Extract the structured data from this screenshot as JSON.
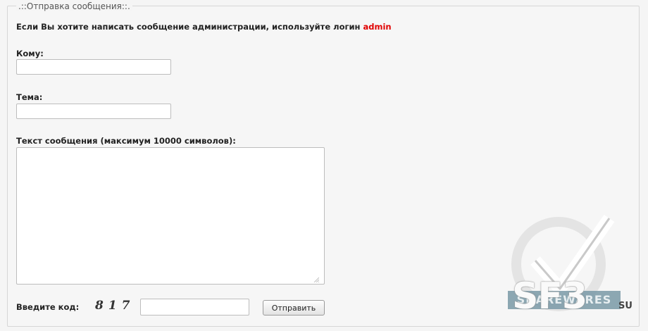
{
  "form": {
    "legend": ".::Отправка сообщения::.",
    "notice_text": "Если Вы хотите написать сообщение администрации, используйте логин ",
    "notice_login": "admin",
    "to_label": "Кому:",
    "to_value": "",
    "subject_label": "Тема:",
    "subject_value": "",
    "message_label": "Текст сообщения (максимум 10000 символов):",
    "message_value": "",
    "captcha_label": "Введите код:",
    "captcha_code": "817",
    "captcha_value": "",
    "submit_label": "Отправить"
  },
  "watermark": {
    "tag": "SHAREWARES",
    "big": "SF3",
    "suffix": "SU"
  },
  "colors": {
    "accent_login": "#e00000",
    "background": "#f5f5f5",
    "border": "#d6d6d6"
  },
  "icons": {
    "resize": "resize-grip-icon",
    "watermark": "checkmark-icon"
  }
}
